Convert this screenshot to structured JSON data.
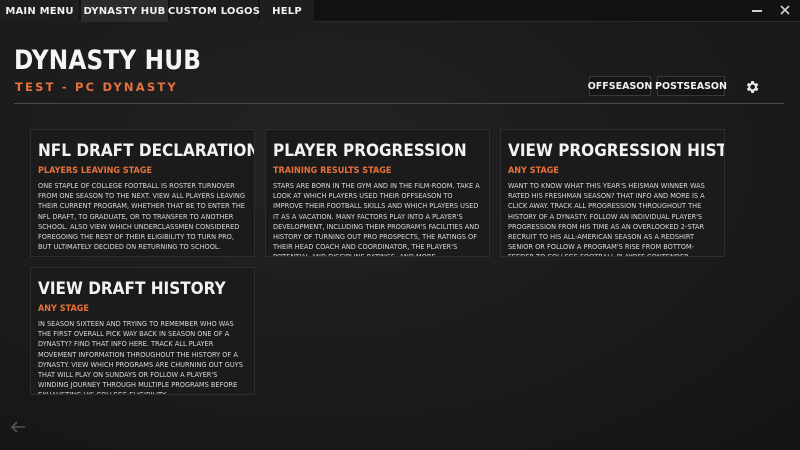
{
  "nav": {
    "items": [
      {
        "label": "MAIN MENU"
      },
      {
        "label": "DYNASTY HUB"
      },
      {
        "label": "CUSTOM LOGOS"
      },
      {
        "label": "HELP"
      }
    ],
    "active_index": 1
  },
  "window_controls": {
    "minimize_icon": "minimize-icon",
    "close_icon": "close-icon"
  },
  "header": {
    "title": "DYNASTY HUB",
    "subtitle": "TEST - PC DYNASTY",
    "buttons": [
      {
        "label": "OFFSEASON"
      },
      {
        "label": "POSTSEASON"
      }
    ],
    "settings_icon": "gear-icon"
  },
  "cards": [
    {
      "title": "NFL DRAFT DECLARATION",
      "stage": "PLAYERS LEAVING STAGE",
      "description": "One staple of college football is roster turnover from one season to the next. View all players leaving their current program, whether that be to enter the NFL draft, to graduate, or to transfer to another school. Also view which underclassmen considered foregoing the rest of their eligibility to turn pro, but ultimately decided on returning to school."
    },
    {
      "title": "PLAYER PROGRESSION",
      "stage": "TRAINING RESULTS STAGE",
      "description": "Stars are born in the gym and in the film-room. Take a look at which players used their offseason to improve their football skills and which players used it as a vacation. Many factors play into a player's development, including their program's facilities and history of turning out pro prospects, the ratings of their head coach and coordinator, the player's potential and discipline ratings, and more."
    },
    {
      "title": "VIEW PROGRESSION HISTORY",
      "stage": "ANY STAGE",
      "description": "Want to know what this year's Heisman winner was rated his freshman season? That info and more is a click away. Track all progression throughout the history of a dynasty. Follow an individual player's progression from his time as an overlooked 2-star recruit to his All-American season as a redshirt senior or follow a program's rise from bottom-feeder to College Football Playoff contender."
    },
    {
      "title": "VIEW DRAFT HISTORY",
      "stage": "ANY STAGE",
      "description": "In season sixteen and trying to remember who was the first overall pick way back in season one of a dynasty? Find that info here. Track all player movement information throughout the history of a dynasty. View which programs are churning out guys that will play on Sundays or follow a player's winding journey through multiple programs before exhausting his college eligibility."
    }
  ],
  "footer": {
    "back_icon": "back-arrow-icon"
  },
  "colors": {
    "accent": "#e8713c",
    "background": "#1b1b1b",
    "nav_bg": "#121212"
  }
}
